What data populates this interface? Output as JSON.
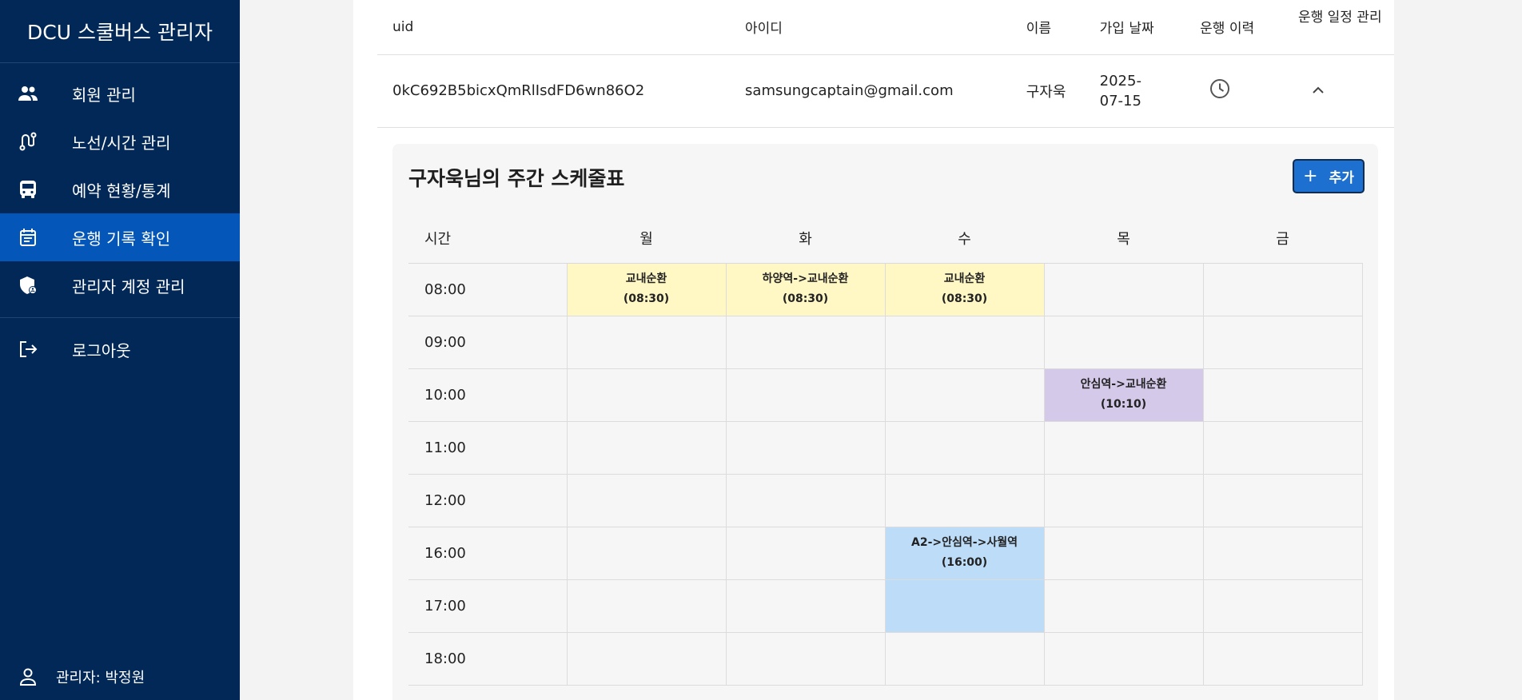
{
  "app_title": "DCU 스쿨버스 관리자",
  "sidebar": {
    "items": [
      {
        "label": "회원 관리",
        "icon": "people-icon",
        "active": false
      },
      {
        "label": "노선/시간 관리",
        "icon": "route-icon",
        "active": false
      },
      {
        "label": "예약 현황/통계",
        "icon": "bus-icon",
        "active": false
      },
      {
        "label": "운행 기록 확인",
        "icon": "event-note-icon",
        "active": true
      },
      {
        "label": "관리자 계정 관리",
        "icon": "admin-shield-icon",
        "active": false
      }
    ],
    "logout_label": "로그아웃",
    "admin_label": "관리자: 박정원"
  },
  "user_table": {
    "headers": [
      "uid",
      "아이디",
      "이름",
      "가입 날짜",
      "운행 이력",
      "운행 일정 관리"
    ],
    "row": {
      "uid": "0kC692B5bicxQmRlIsdFD6wn86O2",
      "email": "samsungcaptain@gmail.com",
      "name": "구자욱",
      "joined": "2025-07-15"
    }
  },
  "schedule": {
    "title": "구자욱님의 주간 스케줄표",
    "add_label": "추가",
    "time_header": "시간",
    "days": [
      "월",
      "화",
      "수",
      "목",
      "금"
    ],
    "rows": [
      {
        "time": "08:00",
        "cells": [
          {
            "route": "교내순환",
            "time": "(08:30)",
            "color": "yellow"
          },
          {
            "route": "하양역->교내순환",
            "time": "(08:30)",
            "color": "yellow"
          },
          {
            "route": "교내순환",
            "time": "(08:30)",
            "color": "yellow"
          },
          null,
          null
        ]
      },
      {
        "time": "09:00",
        "cells": [
          null,
          null,
          null,
          null,
          null
        ]
      },
      {
        "time": "10:00",
        "cells": [
          null,
          null,
          null,
          {
            "route": "안심역->교내순환",
            "time": "(10:10)",
            "color": "purple"
          },
          null
        ]
      },
      {
        "time": "11:00",
        "cells": [
          null,
          null,
          null,
          null,
          null
        ]
      },
      {
        "time": "12:00",
        "cells": [
          null,
          null,
          null,
          null,
          null
        ]
      },
      {
        "time": "16:00",
        "cells": [
          null,
          null,
          {
            "route": "A2->안심역->사월역",
            "time": "(16:00)",
            "color": "blue"
          },
          null,
          null
        ]
      },
      {
        "time": "17:00",
        "cells": [
          null,
          null,
          {
            "route": "",
            "time": "",
            "color": "blue-cont"
          },
          null,
          null
        ]
      },
      {
        "time": "18:00",
        "cells": [
          null,
          null,
          null,
          null,
          null
        ]
      }
    ]
  },
  "colors": {
    "sidebar_bg": "#012856",
    "sidebar_active": "#0457b8",
    "accent": "#1d6fd0",
    "slot_yellow": "#fff7c4",
    "slot_purple": "#d5c9ea",
    "slot_blue": "#bcdcf8"
  }
}
